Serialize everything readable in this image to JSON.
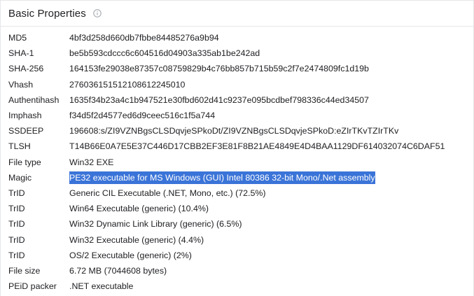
{
  "header": {
    "title": "Basic Properties",
    "info_icon": "info-circle-icon"
  },
  "colors": {
    "selection_bg": "#3b74d8",
    "selection_text": "#ffffff",
    "border": "#e4e6ea",
    "text": "#202124"
  },
  "properties": [
    {
      "label": "MD5",
      "value": "4bf3d258d660db7fbbe84485276a9b94"
    },
    {
      "label": "SHA-1",
      "value": "be5b593cdccc6c604516d04903a335ab1be242ad"
    },
    {
      "label": "SHA-256",
      "value": "164153fe29038e87357c08759829b4c76bb857b715b59c2f7e2474809fc1d19b"
    },
    {
      "label": "Vhash",
      "value": "27603615151210861224501​0"
    },
    {
      "label": "Authentihash",
      "value": "1635f34b23a4c1b947521e30fbd602d41c9237e095bcdbef798336c44ed34507"
    },
    {
      "label": "Imphash",
      "value": "f34d5f2d4577ed6d9ceec516c1f5a744"
    },
    {
      "label": "SSDEEP",
      "value": "196608:s/ZI9VZNBgsCLSDqvjeSPkoDt/ZI9VZNBgsCLSDqvjeSPkoD:eZIrTKvTZIrTKv"
    },
    {
      "label": "TLSH",
      "value": "T14B66E0A7E5E37C446D17CBB2EF3E81F8B21AE4849E4D4BAA1129DF614032074C6DAF51"
    },
    {
      "label": "File type",
      "value": "Win32 EXE"
    },
    {
      "label": "Magic",
      "value": "PE32 executable for MS Windows (GUI) Intel 80386 32-bit Mono/.Net assembly",
      "selected": true
    },
    {
      "label": "TrID",
      "value": "Generic CIL Executable (.NET, Mono, etc.) (72.5%)"
    },
    {
      "label": "TrID",
      "value": "Win64 Executable (generic) (10.4%)"
    },
    {
      "label": "TrID",
      "value": "Win32 Dynamic Link Library (generic) (6.5%)"
    },
    {
      "label": "TrID",
      "value": "Win32 Executable (generic) (4.4%)"
    },
    {
      "label": "TrID",
      "value": "OS/2 Executable (generic) (2%)"
    },
    {
      "label": "File size",
      "value": "6.72 MB (7044608 bytes)"
    },
    {
      "label": "PEiD packer",
      "value": ".NET executable"
    }
  ]
}
